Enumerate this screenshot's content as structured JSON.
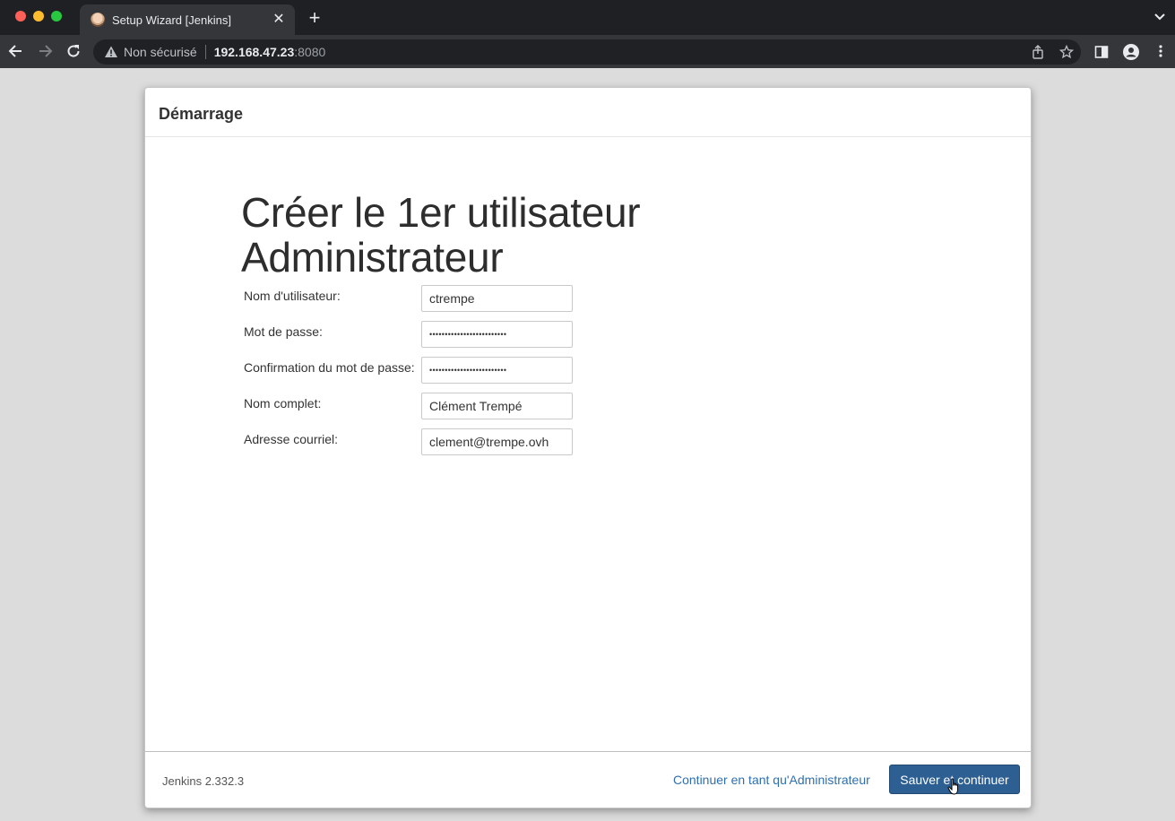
{
  "browser": {
    "tab_title": "Setup Wizard [Jenkins]",
    "tab_close": "✕",
    "new_tab": "+",
    "security_label": "Non sécurisé",
    "url_host": "192.168.47.23",
    "url_port": ":8080"
  },
  "dialog": {
    "header": "Démarrage",
    "title": "Créer le 1er utilisateur Administrateur",
    "fields": [
      {
        "label": "Nom d'utilisateur:",
        "value": "ctrempe"
      },
      {
        "label": "Mot de passe:",
        "value": "•••••••••••••••••••••••••"
      },
      {
        "label": "Confirmation du mot de passe:",
        "value": "•••••••••••••••••••••••••"
      },
      {
        "label": "Nom complet:",
        "value": "Clément Trempé"
      },
      {
        "label": "Adresse courriel:",
        "value": "clement@trempe.ovh"
      }
    ],
    "footer": {
      "version": "Jenkins 2.332.3",
      "skip_link": "Continuer en tant qu'Administrateur",
      "save_button": "Sauver et continuer"
    }
  },
  "colors": {
    "primary_button": "#2d5f93",
    "link": "#2f6fb0"
  }
}
